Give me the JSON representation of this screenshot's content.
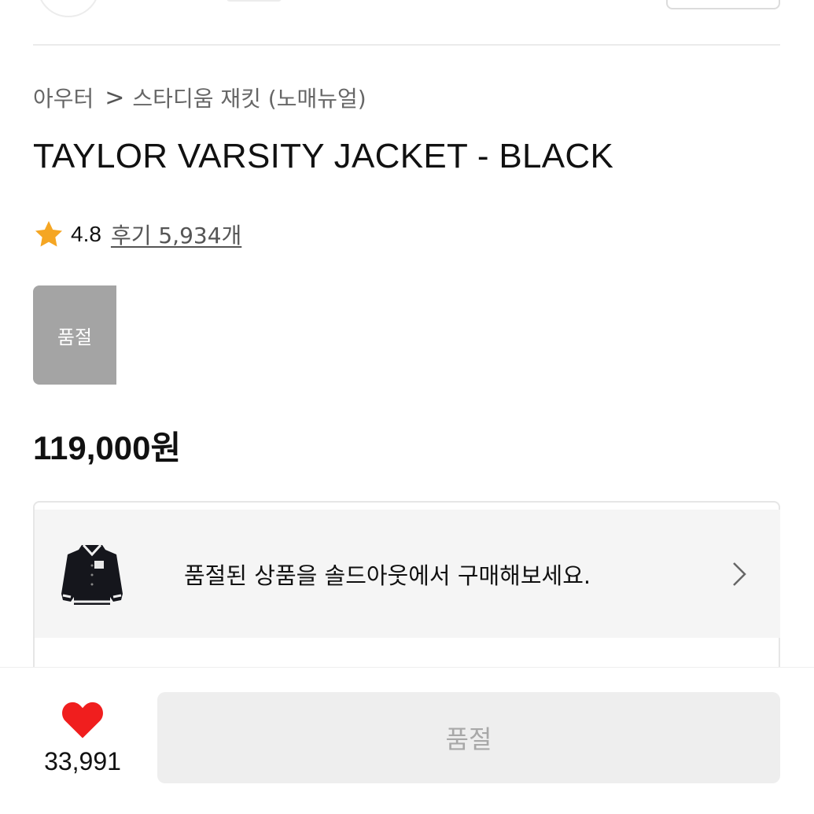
{
  "header": {
    "avatar_icon": "profile-avatar-icon"
  },
  "breadcrumb": {
    "category": "아우터",
    "separator": ">",
    "subcategory": "스타디움 재킷 (노매뉴얼)"
  },
  "product": {
    "title": "TAYLOR VARSITY JACKET - BLACK",
    "rating": "4.8",
    "review_label": "후기 5,934개",
    "rating_star_color": "#F5A623",
    "soldout_badge": "품절",
    "price": "119,000원"
  },
  "soldout_banner": {
    "thumbnail_icon": "varsity-jacket-thumbnail",
    "text": "품절된 상품을 솔드아웃에서 구매해보세요."
  },
  "bottom_bar": {
    "like_count": "33,991",
    "heart_color": "#F01E1E",
    "buy_label": "품절"
  }
}
